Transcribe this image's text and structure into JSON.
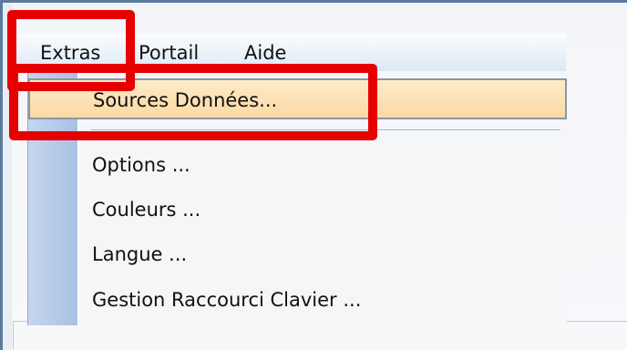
{
  "menubar": {
    "items": [
      {
        "label": "Extras"
      },
      {
        "label": "Portail"
      },
      {
        "label": "Aide"
      }
    ]
  },
  "dropdown": {
    "items": [
      {
        "label": "Sources Données...",
        "state": "highlighted"
      },
      {
        "label": "Options ..."
      },
      {
        "label": "Couleurs ..."
      },
      {
        "label": "Langue ..."
      },
      {
        "label": "Gestion Raccourci Clavier ..."
      }
    ]
  },
  "annotation_color": "#e60000",
  "highlight_color": "#fbd9a4"
}
